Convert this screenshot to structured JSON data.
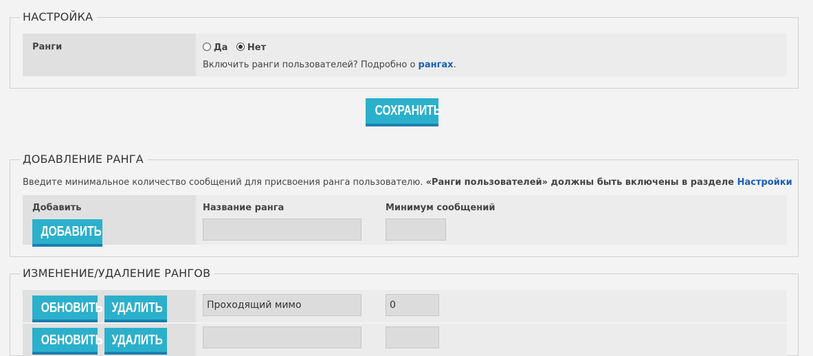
{
  "settings": {
    "legend": "НАСТРОЙКА",
    "ranks_label": "Ранги",
    "radio_yes": "Да",
    "radio_no": "Нет",
    "selected": "no",
    "help_text": "Включить ранги пользователей? Подробно о ",
    "help_link": "рангах",
    "help_suffix": ".",
    "save_button": "СОХРАНИТЬ"
  },
  "add_rank": {
    "legend": "ДОБАВЛЕНИЕ РАНГА",
    "intro_text": "Введите минимальное количество сообщений для присвоения ранга пользователю. ",
    "intro_bold": "«Ранги пользователей» должны быть включены в разделе ",
    "intro_link": "Настройки",
    "add_label": "Добавить",
    "add_button": "ДОБАВИТЬ",
    "col_name": "Название ранга",
    "col_min": "Минимум сообщений",
    "name_value": "",
    "min_value": ""
  },
  "edit_ranks": {
    "legend": "ИЗМЕНЕНИЕ/УДАЛЕНИЕ РАНГОВ",
    "update_button": "ОБНОВИТЬ",
    "delete_button": "УДАЛИТЬ",
    "rows": [
      {
        "name": "Проходящий мимо",
        "min": "0"
      },
      {
        "name": "",
        "min": ""
      }
    ]
  },
  "colors": {
    "accent": "#2bb0cc",
    "accent_border": "#1a7fb0",
    "link": "#1a5fb8"
  }
}
